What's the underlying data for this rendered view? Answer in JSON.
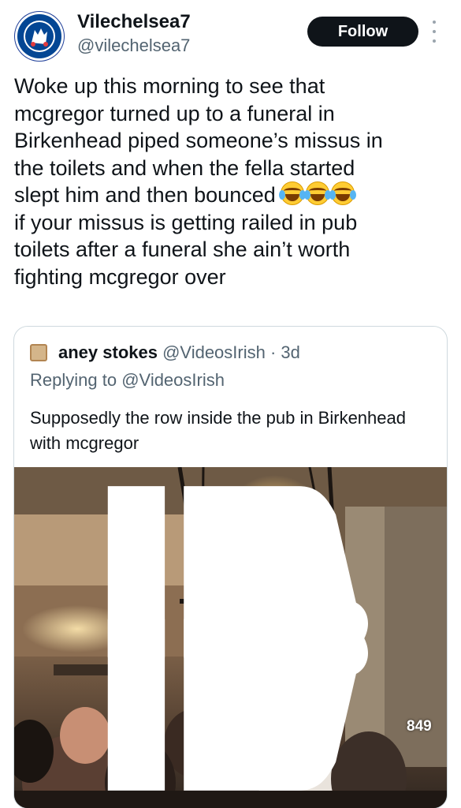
{
  "author": {
    "display_name": "Vilechelsea7",
    "handle": "@vilechelsea7",
    "avatar_icon": "chelsea-crest-icon"
  },
  "follow_label": "Follow",
  "tweet": {
    "line1": "Woke up this morning to see that",
    "line2": "mcgregor turned up to a funeral in",
    "line3": "Birkenhead piped someone’s missus in",
    "line4": "the toilets and when the fella started",
    "line5": "slept him and then bounced",
    "emojis": "😂😂😂",
    "line6": "if your missus is getting railed in pub",
    "line7": "toilets after a funeral she ain’t worth",
    "line8": "fighting mcgregor over"
  },
  "quoted": {
    "name": "aney stokes",
    "handle": "@VideosIrish",
    "time": "· 3d",
    "replying_prefix": "Replying to",
    "replying_handle": "@VideosIrish",
    "text": "Supposedly the row inside the pub in Birkenhead with mcgregor"
  },
  "media": {
    "like_count": "849",
    "like_icon": "thumbs-up-icon",
    "dislike_icon": "thumbs-down-icon"
  },
  "colors": {
    "follow_bg": "#0f1419",
    "secondary_text": "#536471",
    "border": "#cfd9de"
  }
}
